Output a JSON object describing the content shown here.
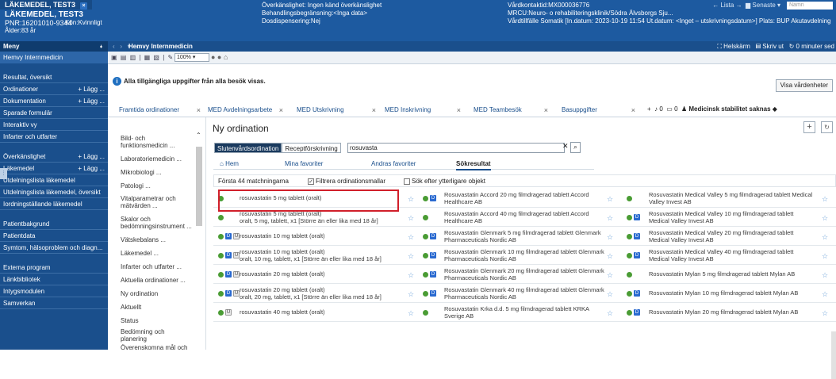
{
  "header": {
    "tab_title": "LÄKEMEDEL, TEST3",
    "patient_name": "LÄKEMEDEL, TEST3",
    "pnr": "PNR:16201010-9344",
    "gender": "Kön:Kvinnligt",
    "age": "Ålder:83 år",
    "alerts": [
      "Överkänslighet: Ingen känd överkänslighet",
      "Behandlingsbegränsning:<Inga data>",
      "Dosdispensering:Nej"
    ],
    "context": [
      "Vårdkontaktid:MX000036776",
      "MRCU:Neuro- o rehabiliteringsklinik/Södra Älvsborgs Sju...",
      "Vårdtillfälle Somatik [In.datum: 2023-10-19 11:54 Ut.datum: <Inget – utskrivningsdatum>] Plats: BUP Akutavdelning"
    ],
    "links": {
      "lista": "← Lista →",
      "senaste": "Senaste ▾"
    },
    "search_placeholder": "Namn"
  },
  "sidebar": {
    "menu_label": "Meny",
    "items": [
      {
        "label": "Hemvy Internmedicin",
        "active": true
      },
      {
        "label": "Resultat, översikt"
      },
      {
        "label": "Ordinationer",
        "lagg": "+ Lägg ..."
      },
      {
        "label": "Dokumentation",
        "lagg": "+ Lägg ..."
      },
      {
        "label": "Sparade formulär"
      },
      {
        "label": "Interaktiv vy"
      },
      {
        "label": "Infarter och utfarter"
      },
      {
        "label": "Överkänslighet",
        "lagg": "+ Lägg ..."
      },
      {
        "label": "Läkemedel",
        "lagg": "+ Lägg ..."
      },
      {
        "label": "Utdelningslista läkemedel"
      },
      {
        "label": "Utdelningslista läkemedel, översikt"
      },
      {
        "label": "Iordningställande läkemedel"
      },
      {
        "label": "Patientbakgrund"
      },
      {
        "label": "Patientdata"
      },
      {
        "label": "Symtom, hälsoproblem och diagn..."
      },
      {
        "label": "Externa program"
      },
      {
        "label": "Länkbibliotek"
      },
      {
        "label": "Intygsmodulen"
      },
      {
        "label": "Samverkan"
      }
    ]
  },
  "navbar": {
    "title": "Hemvy Internmedicin",
    "helskarm": "Helskärm",
    "skrivut": "Skriv ut",
    "updated": "0 minuter sed"
  },
  "toolbar": {
    "zoom": "100%"
  },
  "info": {
    "message": "Alla tillgängliga uppgifter från alla besök visas.",
    "visa_button": "Visa vårdenheter"
  },
  "tabs": [
    {
      "label": "Framtida ordinationer"
    },
    {
      "label": "MED Avdelningsarbete"
    },
    {
      "label": "MED Utskrivning"
    },
    {
      "label": "MED Inskrivning"
    },
    {
      "label": "MED Teambesök"
    },
    {
      "label": "Basuppgifter"
    }
  ],
  "tabs_right": {
    "stabilitet": "Medicinsk stabilitet saknas",
    "count1": "0",
    "count2": "0"
  },
  "sublist": [
    "Bild- och",
    "funktionsmedicin ...",
    "Laboratoriemedicin ...",
    "Mikrobiologi ...",
    "Patologi ...",
    "Vitalparametrar och",
    "mätvärden ...",
    "Skalor och",
    "bedömningsinstrument ...",
    "Vätskebalans ...",
    "Läkemedel ...",
    "Infarter och utfarter ...",
    "Aktuella ordinationer ...",
    "Ny ordination",
    "Aktuellt",
    "Status",
    "Bedömning och",
    "planering",
    "Överenskomna mål och"
  ],
  "order": {
    "title": "Ny ordination",
    "search_tabs": [
      "Slutenvårdsordination",
      "Receptförskrivning"
    ],
    "search_value": "rosuvasta",
    "result_tabs": [
      "Hem",
      "Mina favoriter",
      "Andras favoriter",
      "Sökresultat"
    ],
    "filter_count": "Första 44 matchningarna",
    "filter_templates": "Filtrera ordinationsmallar",
    "filter_more": "Sök efter ytterligare objekt",
    "rows": [
      {
        "c1": [
          "rosuvastatin 5 mg tablett (oralt)"
        ],
        "c2": [
          "Rosuvastatin Accord 20 mg filmdragerad tablett Accord",
          "Healthcare AB"
        ],
        "c3": [
          "Rosuvastatin Medical Valley 5 mg filmdragerad tablett Medical",
          "Valley Invest AB"
        ]
      },
      {
        "c1": [
          "rosuvastatin 5 mg tablett (oralt)",
          "oralt, 5 mg, tablett, x1 [Större än eller lika med 18 år]"
        ],
        "c2": [
          "Rosuvastatin Accord 40 mg filmdragerad tablett Accord",
          "Healthcare AB"
        ],
        "c3": [
          "Rosuvastatin Medical Valley 10 mg filmdragerad tablett",
          "Medical Valley Invest AB"
        ]
      },
      {
        "c1": [
          "rosuvastatin 10 mg tablett (oralt)"
        ],
        "c2": [
          "Rosuvastatin Glenmark 5 mg filmdragerad tablett Glenmark",
          "Pharmaceuticals Nordic AB"
        ],
        "c3": [
          "Rosuvastatin Medical Valley 20 mg filmdragerad tablett",
          "Medical Valley Invest AB"
        ]
      },
      {
        "c1": [
          "rosuvastatin 10 mg tablett (oralt)",
          "oralt, 10 mg, tablett, x1 [Större än eller lika med 18 år]"
        ],
        "c2": [
          "Rosuvastatin Glenmark 10 mg filmdragerad tablett Glenmark",
          "Pharmaceuticals Nordic AB"
        ],
        "c3": [
          "Rosuvastatin Medical Valley 40 mg filmdragerad tablett",
          "Medical Valley Invest AB"
        ]
      },
      {
        "c1": [
          "rosuvastatin 20 mg tablett (oralt)"
        ],
        "c2": [
          "Rosuvastatin Glenmark 20 mg filmdragerad tablett Glenmark",
          "Pharmaceuticals Nordic AB"
        ],
        "c3": [
          "Rosuvastatin Mylan 5 mg filmdragerad tablett Mylan AB"
        ]
      },
      {
        "c1": [
          "rosuvastatin 20 mg tablett (oralt)",
          "oralt, 20 mg, tablett, x1 [Större än eller lika med 18 år]"
        ],
        "c2": [
          "Rosuvastatin Glenmark 40 mg filmdragerad tablett Glenmark",
          "Pharmaceuticals Nordic AB"
        ],
        "c3": [
          "Rosuvastatin Mylan 10 mg filmdragerad tablett Mylan AB"
        ]
      },
      {
        "c1": [
          "rosuvastatin 40 mg tablett (oralt)"
        ],
        "c2": [
          "Rosuvastatin Krka d.d. 5 mg filmdragerad tablett KRKA",
          "Sverige AB"
        ],
        "c3": [
          "Rosuvastatin Mylan 20 mg filmdragerad tablett Mylan AB"
        ]
      }
    ]
  }
}
